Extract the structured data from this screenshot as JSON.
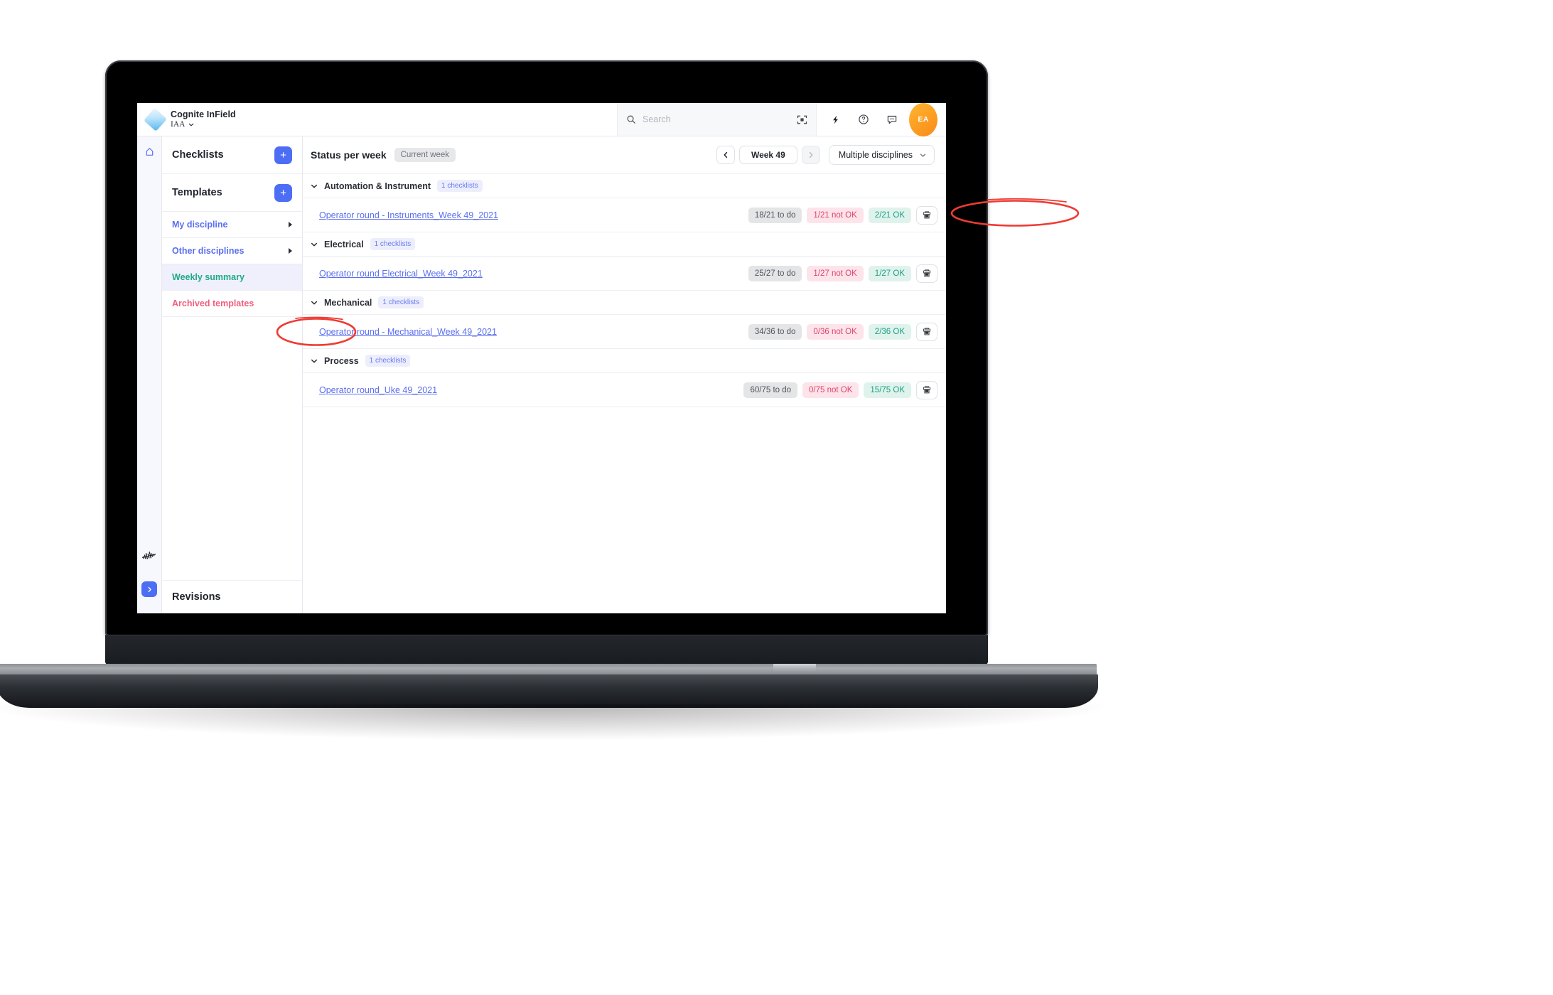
{
  "app": {
    "brand_title": "Cognite InField",
    "project": "IAA",
    "search_placeholder": "Search",
    "avatar_initials": "EA",
    "icons": {
      "logo": "cognite-diamond-logo",
      "caret": "chevron-down-icon",
      "search": "search-icon",
      "scan": "scan-target-icon",
      "bolt": "lightning-bolt-icon",
      "help": "help-circle-icon",
      "feedback": "chat-bubble-icon",
      "home": "home-icon",
      "rail_logo": "cognite-bars-logo",
      "expand": "chevron-right-icon",
      "pdf": "pdf-print-icon"
    }
  },
  "sidebar": {
    "sections": {
      "checklists": "Checklists",
      "templates": "Templates",
      "revisions": "Revisions"
    },
    "add_label": "+",
    "items": [
      {
        "label": "My discipline",
        "color": "indigo",
        "has_arrow": true,
        "selected": false
      },
      {
        "label": "Other disciplines",
        "color": "indigo",
        "has_arrow": true,
        "selected": false
      },
      {
        "label": "Weekly summary",
        "color": "teal",
        "has_arrow": false,
        "selected": true
      },
      {
        "label": "Archived templates",
        "color": "pink",
        "has_arrow": false,
        "selected": false
      }
    ]
  },
  "main": {
    "title": "Status per week",
    "current_week_chip": "Current week",
    "prev_label": "‹",
    "week_label": "Week 49",
    "next_label": "›",
    "discipline_filter": "Multiple disciplines",
    "groups": [
      {
        "name": "Automation & Instrument",
        "count_badge": "1 checklists",
        "rows": [
          {
            "name": "Operator round - Instruments_Week 49_2021",
            "todo": "18/21 to do",
            "not_ok": "1/21 not OK",
            "ok": "2/21 OK"
          }
        ]
      },
      {
        "name": "Electrical",
        "count_badge": "1 checklists",
        "rows": [
          {
            "name": "Operator round Electrical_Week 49_2021",
            "todo": "25/27 to do",
            "not_ok": "1/27 not OK",
            "ok": "1/27 OK"
          }
        ]
      },
      {
        "name": "Mechanical",
        "count_badge": "1 checklists",
        "rows": [
          {
            "name": "Operator round - Mechanical_Week 49_2021",
            "todo": "34/36 to do",
            "not_ok": "0/36 not OK",
            "ok": "2/36 OK"
          }
        ]
      },
      {
        "name": "Process",
        "count_badge": "1 checklists",
        "rows": [
          {
            "name": "Operator round_Uke 49_2021",
            "todo": "60/75 to do",
            "not_ok": "0/75 not OK",
            "ok": "15/75 OK"
          }
        ]
      }
    ]
  },
  "annotations": [
    {
      "name": "weekly-summary-highlight",
      "shape": "ellipse",
      "color": "#ee3b34"
    },
    {
      "name": "discipline-filter-highlight",
      "shape": "ellipse",
      "color": "#ee3b34"
    }
  ],
  "colors": {
    "accent_indigo": "#4c6ef5",
    "link_indigo": "#5a6ff0",
    "teal": "#1fa98a",
    "pink": "#ef5f7e",
    "status_todo_bg": "#e4e5e7",
    "status_notok_bg": "#fce4ea",
    "status_ok_bg": "#dff3ec",
    "annotation_red": "#ee3b34",
    "avatar_orange": "#f98a17"
  }
}
